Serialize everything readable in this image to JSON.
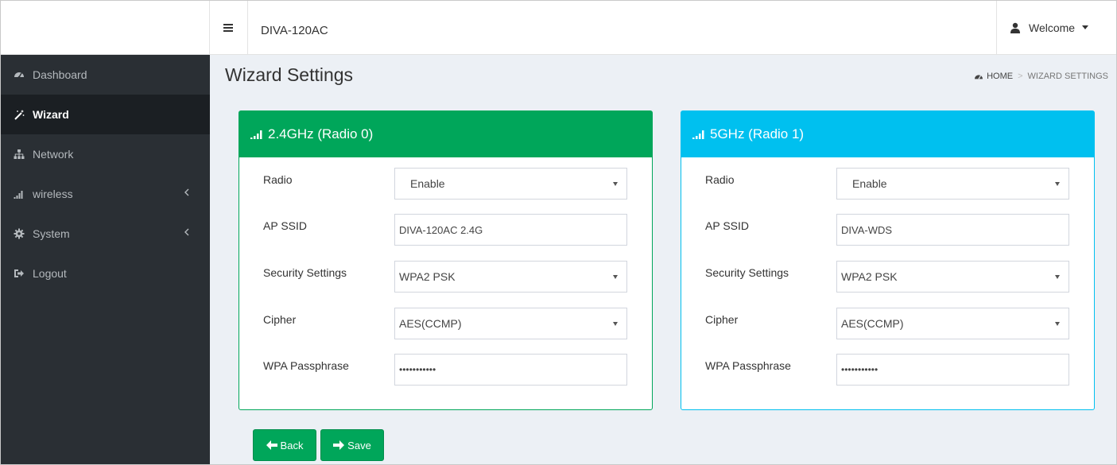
{
  "header": {
    "device_name": "DIVA-120AC",
    "user_label": "Welcome"
  },
  "sidebar": {
    "items": [
      {
        "label": "Dashboard",
        "icon": "dashboard-icon"
      },
      {
        "label": "Wizard",
        "icon": "magic-wand-icon"
      },
      {
        "label": "Network",
        "icon": "sitemap-icon"
      },
      {
        "label": "wireless",
        "icon": "signal-icon"
      },
      {
        "label": "System",
        "icon": "gear-icon"
      },
      {
        "label": "Logout",
        "icon": "sign-out-icon"
      }
    ]
  },
  "page": {
    "title": "Wizard Settings",
    "breadcrumb_home": "HOME",
    "breadcrumb_separator": ">",
    "breadcrumb_current": "WIZARD SETTINGS"
  },
  "radios": [
    {
      "title": "2.4GHz (Radio 0)",
      "color": "#00a65a",
      "fields": {
        "radio_label": "Radio",
        "radio_value": "Enable",
        "ssid_label": "AP SSID",
        "ssid_value": "DIVA-120AC 2.4G",
        "security_label": "Security Settings",
        "security_value": "WPA2 PSK",
        "cipher_label": "Cipher",
        "cipher_value": "AES(CCMP)",
        "passphrase_label": "WPA Passphrase",
        "passphrase_value": "•••••••••••"
      }
    },
    {
      "title": "5GHz (Radio 1)",
      "color": "#00c0ef",
      "fields": {
        "radio_label": "Radio",
        "radio_value": "Enable",
        "ssid_label": "AP SSID",
        "ssid_value": "DIVA-WDS",
        "security_label": "Security Settings",
        "security_value": "WPA2 PSK",
        "cipher_label": "Cipher",
        "cipher_value": "AES(CCMP)",
        "passphrase_label": "WPA Passphrase",
        "passphrase_value": "•••••••••••"
      }
    }
  ],
  "buttons": {
    "back_label": "Back",
    "save_label": "Save"
  }
}
